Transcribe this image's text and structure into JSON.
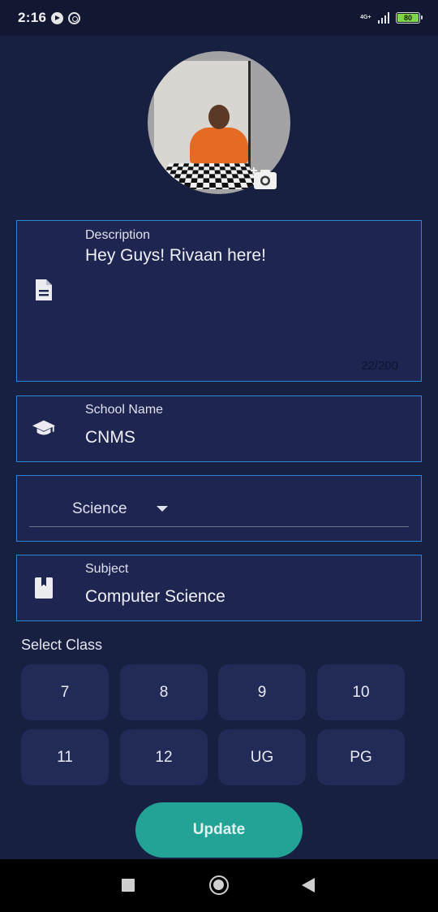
{
  "status_bar": {
    "time": "2:16",
    "network": "4G+",
    "battery": "80",
    "battery_color": "#7cd645"
  },
  "avatar": {
    "image": "profile-photo",
    "edit_icon": "add-photo-icon"
  },
  "form": {
    "description": {
      "label": "Description",
      "value": "Hey Guys! Rivaan here!",
      "counter": "22/200",
      "icon": "document-icon"
    },
    "school": {
      "label": "School Name",
      "value": "CNMS",
      "icon": "graduation-cap-icon"
    },
    "stream": {
      "selected": "Science",
      "icon": "dropdown-arrow-icon"
    },
    "subject": {
      "label": "Subject",
      "value": "Computer Science",
      "icon": "book-icon"
    }
  },
  "select_class": {
    "title": "Select Class",
    "options": [
      "7",
      "8",
      "9",
      "10",
      "11",
      "12",
      "UG",
      "PG"
    ]
  },
  "update_button": {
    "label": "Update",
    "color": "#22a396"
  },
  "colors": {
    "background": "#182042",
    "field_border": "#2c86d6",
    "field_fill": "#1d2550",
    "class_button": "#222b57"
  }
}
